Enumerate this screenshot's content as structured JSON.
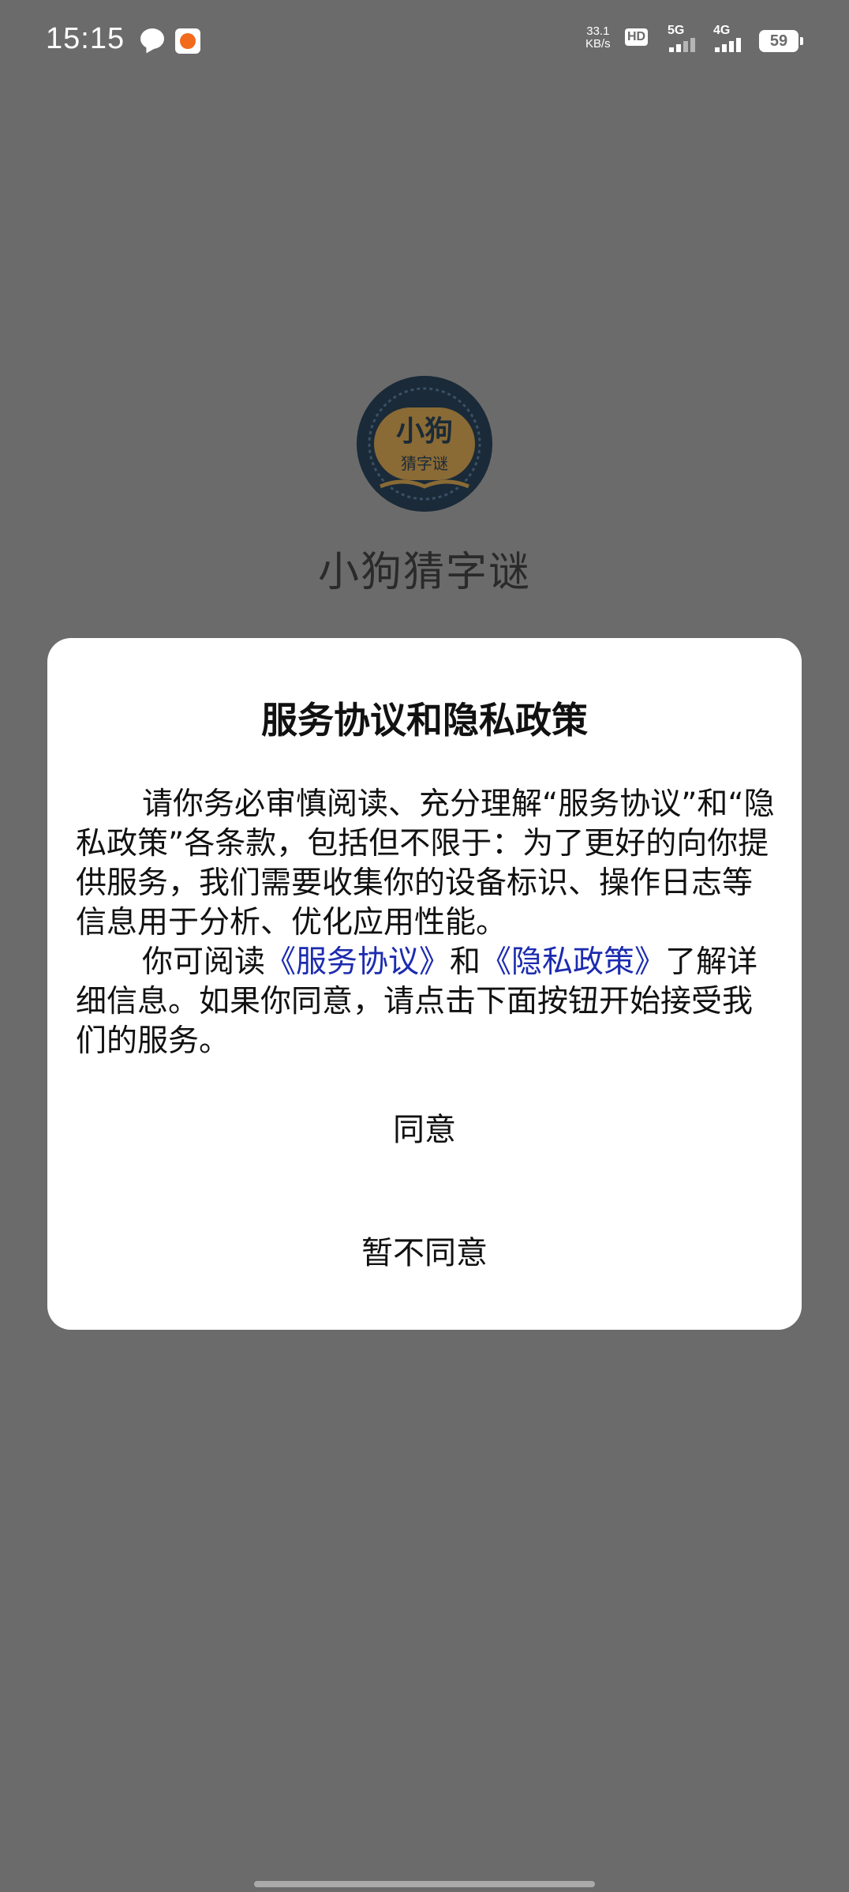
{
  "status_bar": {
    "time": "15:15",
    "net_speed_value": "33.1",
    "net_speed_unit": "KB/s",
    "hd_label": "HD",
    "sim1_label": "5G",
    "sim2_label": "4G",
    "battery_level": "59",
    "icons": [
      "chat-notification-icon",
      "app-notification-icon",
      "signal-icon",
      "battery-icon"
    ]
  },
  "background_app": {
    "logo_text_top": "小狗",
    "logo_text_bottom": "猜字谜",
    "name": "小狗猜字谜"
  },
  "dialog": {
    "title": "服务协议和隐私政策",
    "paragraph1": "请你务必审慎阅读、充分理解“服务协议”和“隐私政策”各条款，包括但不限于：为了更好的向你提供服务，我们需要收集你的设备标识、操作日志等信息用于分析、优化应用性能。",
    "paragraph2_prefix": "你可阅读",
    "service_link": "《服务协议》",
    "paragraph2_and": "和",
    "privacy_link": "《隐私政策》",
    "paragraph2_suffix": "了解详细信息。如果你同意，请点击下面按钮开始接受我们的服务。",
    "agree_label": "同意",
    "disagree_label": "暂不同意",
    "link_color": "#1c2bb0"
  }
}
